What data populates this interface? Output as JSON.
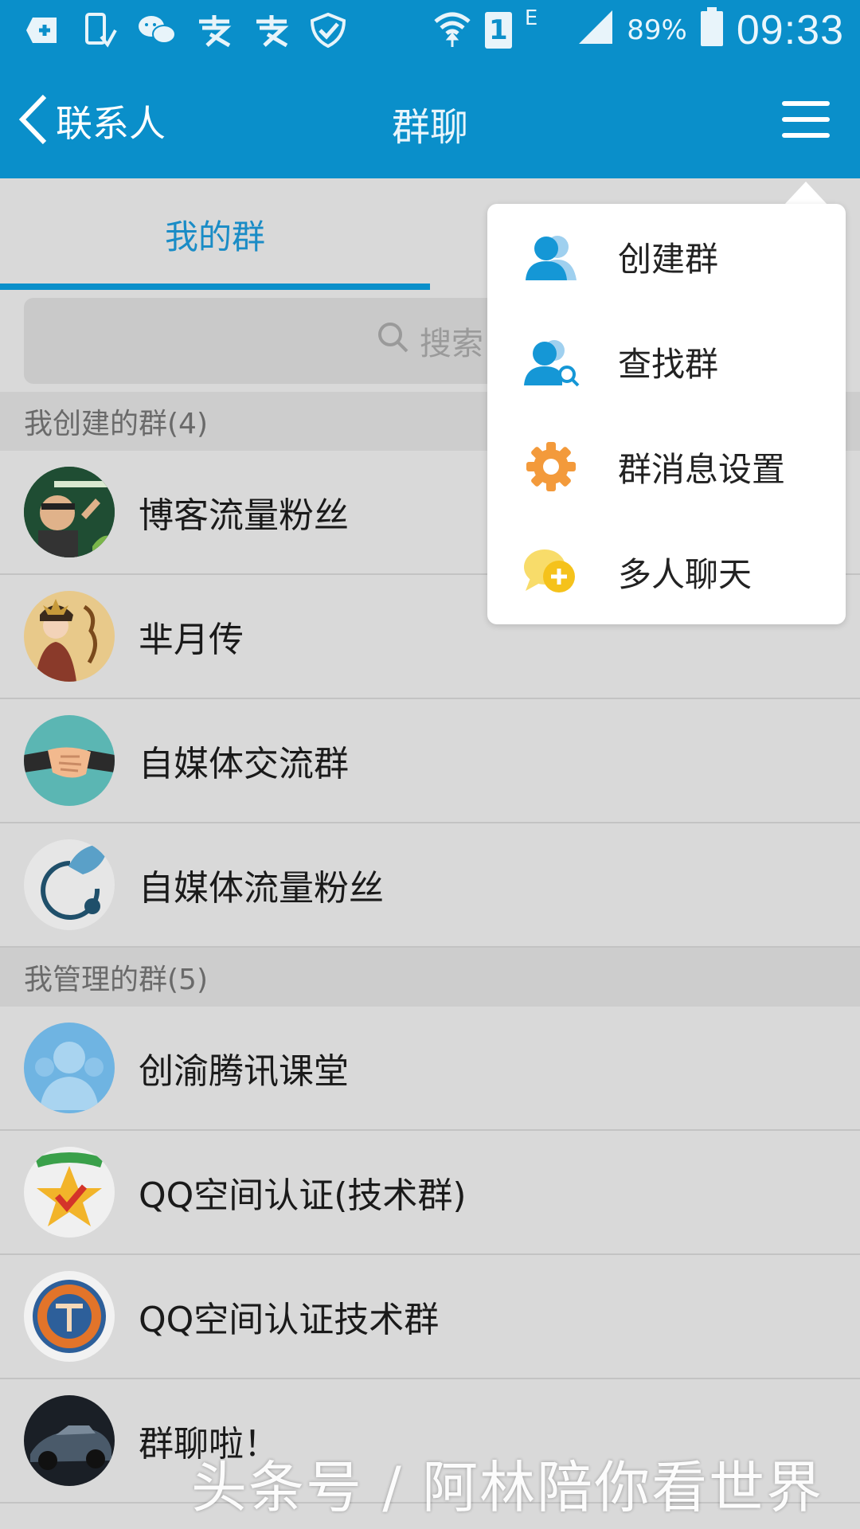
{
  "status_bar": {
    "icons": [
      "add-box-icon",
      "notification-phone-icon",
      "wechat-icon",
      "alipay-icon",
      "alipay-icon-2",
      "shield-check-icon"
    ],
    "network": "E",
    "sim": "1",
    "battery_percent": "89%",
    "time": "09:33"
  },
  "header": {
    "back_label": "联系人",
    "title": "群聊",
    "menu_icon": "hamburger-icon"
  },
  "tabs": [
    {
      "label": "我的群",
      "active": true
    }
  ],
  "search": {
    "placeholder": "搜索"
  },
  "sections": [
    {
      "title": "我创建的群(4)",
      "groups": [
        "博客流量粉丝",
        "芈月传",
        "自媒体交流群",
        "自媒体流量粉丝"
      ]
    },
    {
      "title": "我管理的群(5)",
      "groups": [
        "创渝腾讯课堂",
        "QQ空间认证(技术群)",
        "QQ空间认证技术群",
        "群聊啦！"
      ]
    }
  ],
  "dropdown": {
    "items": [
      {
        "label": "创建群",
        "icon": "create-group-icon",
        "color": "#1597d6"
      },
      {
        "label": "查找群",
        "icon": "search-group-icon",
        "color": "#1597d6"
      },
      {
        "label": "群消息设置",
        "icon": "gear-icon",
        "color": "#f39a3b"
      },
      {
        "label": "多人聊天",
        "icon": "multi-chat-icon",
        "color": "#f5c21b"
      }
    ]
  },
  "watermark": "头条号 / 阿林陪你看世界",
  "colors": {
    "accent": "#0a8fca",
    "background": "#d9d9d9"
  }
}
